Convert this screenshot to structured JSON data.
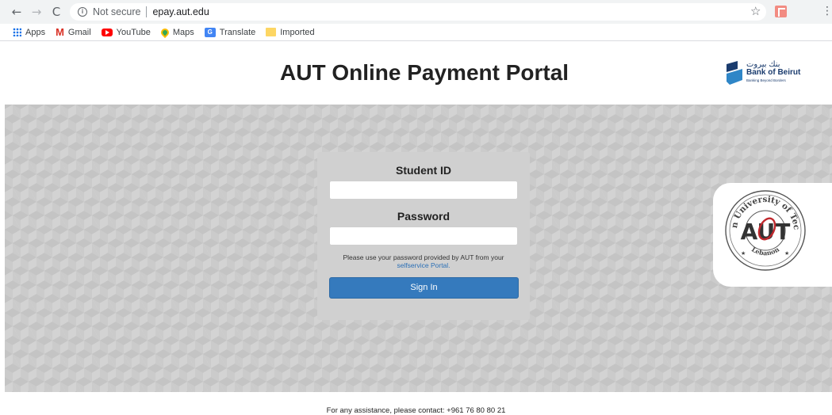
{
  "browser": {
    "security_label": "Not secure",
    "url": "epay.aut.edu",
    "bookmarks": [
      {
        "label": "Apps",
        "icon": "apps-icon"
      },
      {
        "label": "Gmail",
        "icon": "gmail-icon"
      },
      {
        "label": "YouTube",
        "icon": "youtube-icon"
      },
      {
        "label": "Maps",
        "icon": "maps-icon"
      },
      {
        "label": "Translate",
        "icon": "translate-icon"
      },
      {
        "label": "Imported",
        "icon": "folder-icon"
      }
    ]
  },
  "header": {
    "title": "AUT Online Payment Portal",
    "bank_logo": {
      "arabic": "بنك بيروت",
      "name": "Bank of Beirut",
      "tagline": "Banking Beyond Borders"
    }
  },
  "login": {
    "student_id_label": "Student ID",
    "student_id_value": "",
    "password_label": "Password",
    "password_value": "",
    "help_text": "Please use your password provided by AUT from your",
    "help_link": "selfservice Portal.",
    "signin_label": "Sign In"
  },
  "seal": {
    "top_text": "American University of Technology",
    "center_text": "AUT",
    "bottom_text": "Lebanon"
  },
  "footer": {
    "text": "For any assistance, please contact: +961 76 80 80 21"
  },
  "colors": {
    "primary_button": "#357abd",
    "link": "#2a6fb6",
    "bank_blue": "#1b3c6e",
    "seal_red": "#c0282d"
  }
}
